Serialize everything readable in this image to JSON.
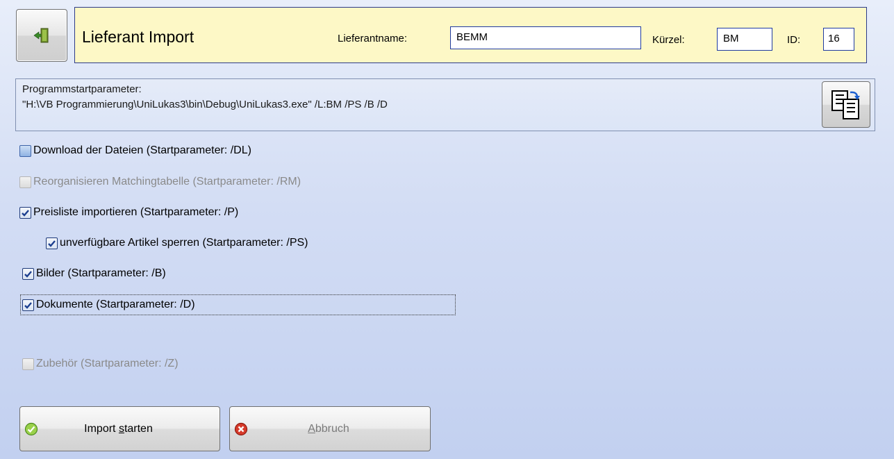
{
  "header": {
    "title": "Lieferant Import",
    "supplier_name_label": "Lieferantname:",
    "supplier_name_value": "BEMM",
    "short_label": "Kürzel:",
    "short_value": "BM",
    "id_label": "ID:",
    "id_value": "16"
  },
  "params": {
    "label": "Programmstartparameter:",
    "command": "\"H:\\VB Programmierung\\UniLukas3\\bin\\Debug\\UniLukas3.exe\" /L:BM /PS /B /D"
  },
  "options": {
    "download": "Download der Dateien (Startparameter: /DL)",
    "reorganize": "Reorganisieren Matchingtabelle (Startparameter: /RM)",
    "pricelist": "Preisliste importieren (Startparameter: /P)",
    "lock_unavailable": "unverfügbare Artikel sperren (Startparameter: /PS)",
    "images": "Bilder (Startparameter: /B)",
    "documents": "Dokumente (Startparameter: /D)",
    "accessories": "Zubehör (Startparameter: /Z)"
  },
  "buttons": {
    "start_pre": "Import ",
    "start_underline": "s",
    "start_post": "tarten",
    "cancel_underline": "A",
    "cancel_post": "bbruch"
  },
  "colors": {
    "header_bg": "#fdf8c6",
    "field_border": "#1f3aa0",
    "check_mark": "#1c3f8f"
  },
  "icons": [
    "exit-door-icon",
    "copy-document-icon",
    "check-ok-icon",
    "cancel-x-icon"
  ]
}
